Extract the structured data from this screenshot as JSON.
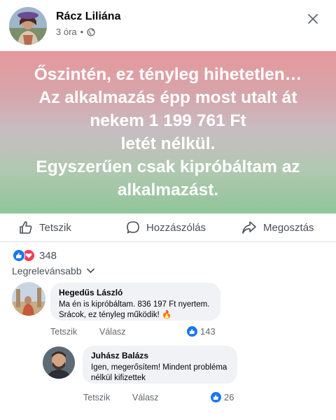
{
  "post": {
    "author": "Rácz Liliána",
    "time": "3 órа",
    "dot": "•",
    "banner_lines": [
      "Őszintén, ez tényleg hihetetlen…",
      "Az alkalmazás épp most utalt át",
      "nekem 1 199 761 Ft",
      "letét nélkül.",
      "Egyszerűen csak kipróbáltam az",
      "alkalmazást."
    ]
  },
  "actions": {
    "like": "Tetszik",
    "comment": "Hozzászólás",
    "share": "Megosztás"
  },
  "reactions": {
    "count": "348",
    "icons": [
      "like-icon",
      "love-icon"
    ]
  },
  "sort": {
    "label": "Legrelevánsabb"
  },
  "comments": [
    {
      "name": "Hegedűs László",
      "lines": [
        "Ma én is kipróbáltam. 836 197 Ft nyertem.",
        "Srácok, ez tényleg működik! 🔥"
      ],
      "like_label": "Tetszik",
      "reply_label": "Válasz",
      "likes": "143"
    },
    {
      "name": "Juhász Balázs",
      "lines": [
        "Igen, megerősítem! Mindent probléma",
        "nélkül kifizettek"
      ],
      "like_label": "Tetszik",
      "reply_label": "Válasz",
      "likes": "26"
    }
  ],
  "colors": {
    "accent": "#1877f2",
    "love": "#f33e58",
    "muted": "#65676b",
    "bubble": "#f0f2f5"
  }
}
